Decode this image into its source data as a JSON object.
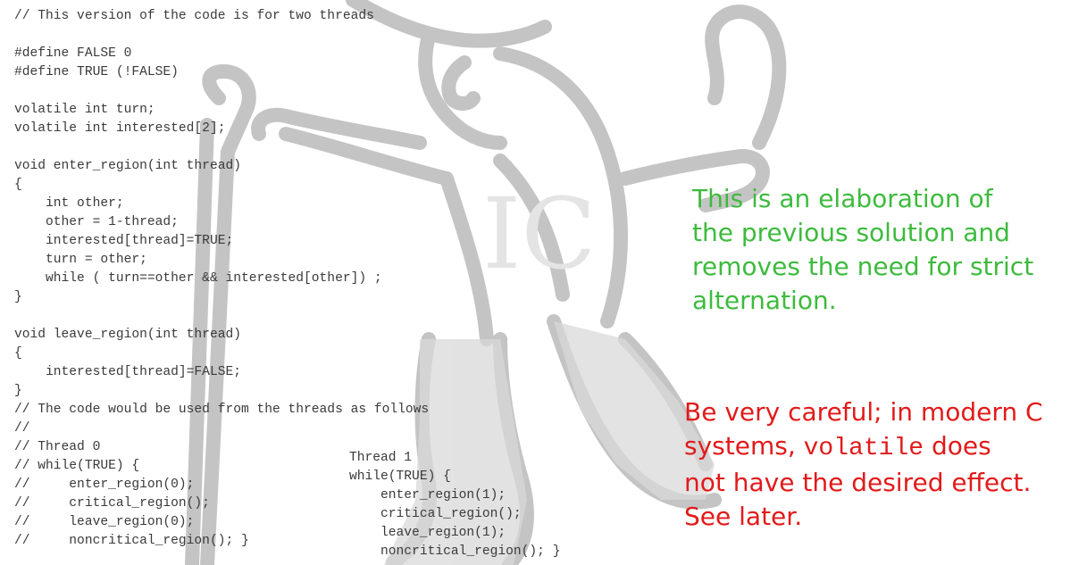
{
  "code_lines": [
    "// This version of the code is for two threads",
    "",
    "#define FALSE 0",
    "#define TRUE (!FALSE)",
    "",
    "volatile int turn;",
    "volatile int interested[2];",
    "",
    "void enter_region(int thread)",
    "{",
    "    int other;",
    "    other = 1-thread;",
    "    interested[thread]=TRUE;",
    "    turn = other;",
    "    while ( turn==other && interested[other]) ;",
    "}",
    "",
    "void leave_region(int thread)",
    "{",
    "    interested[thread]=FALSE;",
    "}",
    "// The code would be used from the threads as follows",
    "//",
    "// Thread 0",
    "// while(TRUE) {",
    "//     enter_region(0);",
    "//     critical_region();",
    "//     leave_region(0);",
    "//     noncritical_region(); }"
  ],
  "thread1_lines": [
    "Thread 1",
    "while(TRUE) {",
    "    enter_region(1);",
    "    critical_region();",
    "    leave_region(1);",
    "    noncritical_region(); }"
  ],
  "note_green": {
    "lines": [
      "This is an elaboration of",
      "the previous solution and",
      "removes the need for strict",
      "alternation."
    ],
    "color": "#3dbb3d"
  },
  "note_red": {
    "line1": "Be very careful; in modern C",
    "line2_pre": "systems, ",
    "line2_mono": "volatile",
    "line2_post": " does",
    "line3": "not have the desired effect.",
    "line4": "See later.",
    "color": "#e21a1a"
  }
}
